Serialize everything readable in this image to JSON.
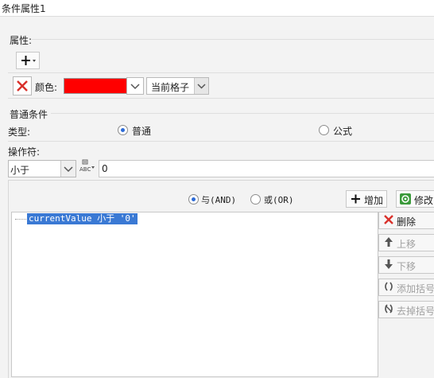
{
  "window": {
    "title": "条件属性1"
  },
  "properties": {
    "section_label": "属性:",
    "add_button_glyph": "+",
    "color_label": "颜色:",
    "color_value": "#ff0000",
    "scope_value": "当前格子"
  },
  "condition": {
    "section_label": "普通条件",
    "type_label": "类型:",
    "type_options": [
      {
        "label": "普通",
        "selected": true
      },
      {
        "label": "公式",
        "selected": false
      }
    ],
    "operator_label": "操作符:",
    "operator_value": "小于",
    "abc_icon_text": "ABC",
    "value_input": "0"
  },
  "logic": {
    "and_label": "与(AND)",
    "or_label": "或(OR)",
    "and_selected": true
  },
  "toolbar": {
    "add_label": "增加",
    "modify_label": "修改"
  },
  "conditions_list": [
    "currentValue 小于 '0'"
  ],
  "side_buttons": [
    {
      "label": "删除",
      "icon": "delete-x-icon",
      "enabled": true
    },
    {
      "label": "上移",
      "icon": "arrow-up-icon",
      "enabled": false
    },
    {
      "label": "下移",
      "icon": "arrow-down-icon",
      "enabled": false
    },
    {
      "label": "添加括号",
      "icon": "add-parentheses-icon",
      "enabled": false
    },
    {
      "label": "去掉括号",
      "icon": "remove-parentheses-icon",
      "enabled": false
    }
  ],
  "colors": {
    "accent": "#2d6bd6",
    "selection": "#3a79d4",
    "delete_red": "#d9312b",
    "modify_green": "#3a9a3a"
  }
}
